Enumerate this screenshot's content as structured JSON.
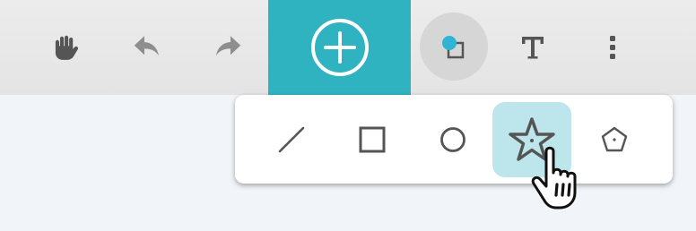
{
  "colors": {
    "accent": "#30b3c1",
    "toolbar_bg": "#e7e7e7",
    "canvas_bg": "#f1f4f8",
    "icon_dark": "#555555",
    "icon_muted": "#8e8e8e",
    "selected_tile": "#bde6ec",
    "shapes_button_bg": "#d6d6d6",
    "shapes_icon_blue": "#2fb4d3"
  },
  "toolbar": {
    "tools": [
      {
        "icon": "hand-icon"
      },
      {
        "icon": "undo-icon"
      },
      {
        "icon": "redo-icon"
      },
      {
        "icon": "add-circle-icon",
        "active": true
      },
      {
        "icon": "shapes-icon",
        "open": true
      },
      {
        "icon": "text-icon"
      },
      {
        "icon": "more-vertical-icon"
      }
    ]
  },
  "shapes_menu": {
    "items": [
      {
        "icon": "line-icon"
      },
      {
        "icon": "square-icon"
      },
      {
        "icon": "circle-icon"
      },
      {
        "icon": "star-icon",
        "selected": true
      },
      {
        "icon": "pentagon-icon"
      }
    ]
  },
  "cursor": {
    "icon": "hand-pointer-cursor-icon"
  }
}
